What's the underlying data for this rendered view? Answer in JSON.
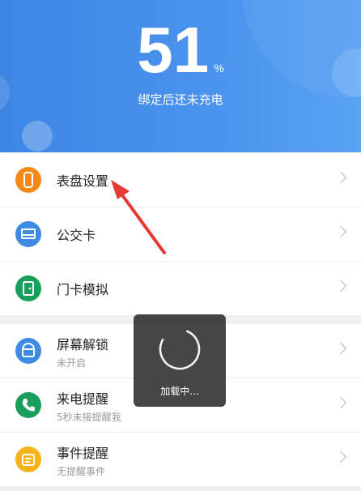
{
  "header": {
    "battery_value": "51",
    "battery_unit": "%",
    "battery_subtitle": "绑定后还未充电"
  },
  "menu_group1": [
    {
      "title": "表盘设置",
      "icon": "watch-face-icon",
      "color": "#f18a16"
    },
    {
      "title": "公交卡",
      "icon": "bus-card-icon",
      "color": "#3d8be4"
    },
    {
      "title": "门卡模拟",
      "icon": "door-card-icon",
      "color": "#1a9e5c"
    }
  ],
  "menu_group2": [
    {
      "title": "屏幕解锁",
      "subtitle": "未开启",
      "icon": "screen-unlock-icon",
      "color": "#3d8be4"
    },
    {
      "title": "来电提醒",
      "subtitle": "5秒未接提醒我",
      "icon": "phone-icon",
      "color": "#1a9e5c"
    },
    {
      "title": "事件提醒",
      "subtitle": "无提醒事件",
      "icon": "event-icon",
      "color": "#f5b319"
    }
  ],
  "loading_toast": {
    "text": "加载中..."
  },
  "annotation_arrow": {
    "color": "#e53935"
  }
}
